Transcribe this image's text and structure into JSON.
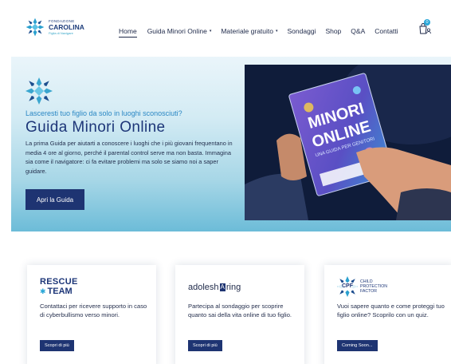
{
  "brand": {
    "line1": "FONDAZIONE",
    "line2": "CAROLINA",
    "line3": "Figlia di Navigare"
  },
  "nav": {
    "items": [
      {
        "label": "Home",
        "active": true,
        "dropdown": false
      },
      {
        "label": "Guida Minori Online",
        "active": false,
        "dropdown": true
      },
      {
        "label": "Materiale gratuito",
        "active": false,
        "dropdown": true
      },
      {
        "label": "Sondaggi",
        "active": false,
        "dropdown": false
      },
      {
        "label": "Shop",
        "active": false,
        "dropdown": false
      },
      {
        "label": "Q&A",
        "active": false,
        "dropdown": false
      },
      {
        "label": "Contatti",
        "active": false,
        "dropdown": false
      }
    ],
    "cart_count": "0",
    "caret": "▾"
  },
  "hero": {
    "kicker": "Lasceresti tuo figlio da solo in luoghi sconosciuti?",
    "title": "Guida Minori Online",
    "text": "La prima Guida per aiutarti a conoscere i luoghi che i più giovani frequentano in media 4 ore al giorno, perché il parental control serve ma non basta. Immagina sia come il navigatore: ci fa evitare problemi ma solo se siamo noi a saper guidare.",
    "button": "Apri la Guida",
    "book": {
      "title_line1": "MINORI",
      "title_line2": "ONLINE",
      "subtitle": "UNA GUIDA PER GENITORI"
    }
  },
  "cards": [
    {
      "logo_line1": "RESCUE",
      "logo_line2": "TEAM",
      "text": "Contattaci per ricevere supporto in caso di cyberbullismo verso minori.",
      "button": "Scopri di più"
    },
    {
      "logo_prefix": "adolesh",
      "logo_mid": "A",
      "logo_suffix": "ring",
      "text": "Partecipa al sondaggio per scoprire quanto sai della vita online di tuo figlio.",
      "button": "Scopri di più"
    },
    {
      "logo_abbr": "CPF",
      "logo_line1": "CHILD",
      "logo_line2": "PROTECTION",
      "logo_line3": "FACTOR",
      "text": "Vuoi sapere quanto e come proteggi tuo figlio online? Scoprilo con un quiz.",
      "button": "Coming Soon..."
    }
  ],
  "colors": {
    "navy": "#1e3472",
    "accent_blue": "#2a87c4",
    "teal": "#2aa7d8"
  }
}
